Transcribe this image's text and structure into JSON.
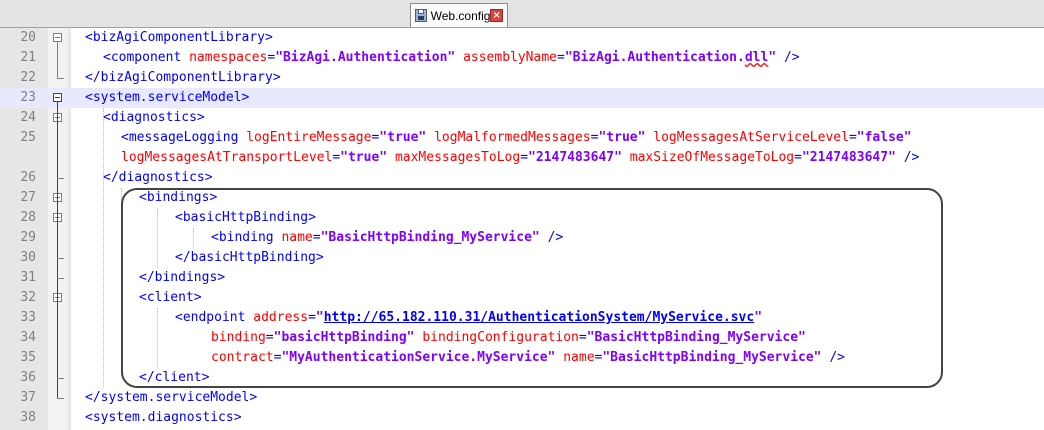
{
  "tab": {
    "label": "Web.config"
  },
  "lines": [
    {
      "n": "20",
      "code": "<bizAgiComponentLibrary>"
    },
    {
      "n": "21",
      "code": "<component namespaces=\"BizAgi.Authentication\" assemblyName=\"BizAgi.Authentication.dll\" />"
    },
    {
      "n": "22",
      "code": "</bizAgiComponentLibrary>"
    },
    {
      "n": "23",
      "code": "<system.serviceModel>"
    },
    {
      "n": "24",
      "code": "<diagnostics>"
    },
    {
      "n": "25",
      "code": "<messageLogging logEntireMessage=\"true\" logMalformedMessages=\"true\" logMessagesAtServiceLevel=\"false\""
    },
    {
      "n": "",
      "code": "logMessagesAtTransportLevel=\"true\" maxMessagesToLog=\"2147483647\" maxSizeOfMessageToLog=\"2147483647\" />"
    },
    {
      "n": "26",
      "code": "</diagnostics>"
    },
    {
      "n": "27",
      "code": "<bindings>"
    },
    {
      "n": "28",
      "code": "<basicHttpBinding>"
    },
    {
      "n": "29",
      "code": "<binding name=\"BasicHttpBinding_MyService\" />"
    },
    {
      "n": "30",
      "code": "</basicHttpBinding>"
    },
    {
      "n": "31",
      "code": "</bindings>"
    },
    {
      "n": "32",
      "code": "<client>"
    },
    {
      "n": "33",
      "code": "<endpoint address=\"http://65.182.110.31/AuthenticationSystem/MyService.svc\""
    },
    {
      "n": "34",
      "code": "binding=\"basicHttpBinding\" bindingConfiguration=\"BasicHttpBinding_MyService\""
    },
    {
      "n": "35",
      "code": "contract=\"MyAuthenticationService.MyService\" name=\"BasicHttpBinding_MyService\" />"
    },
    {
      "n": "36",
      "code": "</client>"
    },
    {
      "n": "37",
      "code": "</system.serviceModel>"
    },
    {
      "n": "38",
      "code": "<system.diagnostics>"
    }
  ],
  "colors": {
    "tag": "#0000ff",
    "attribute": "#ff0000",
    "value": "#8000ff",
    "current_line": "#e8e8ff"
  }
}
